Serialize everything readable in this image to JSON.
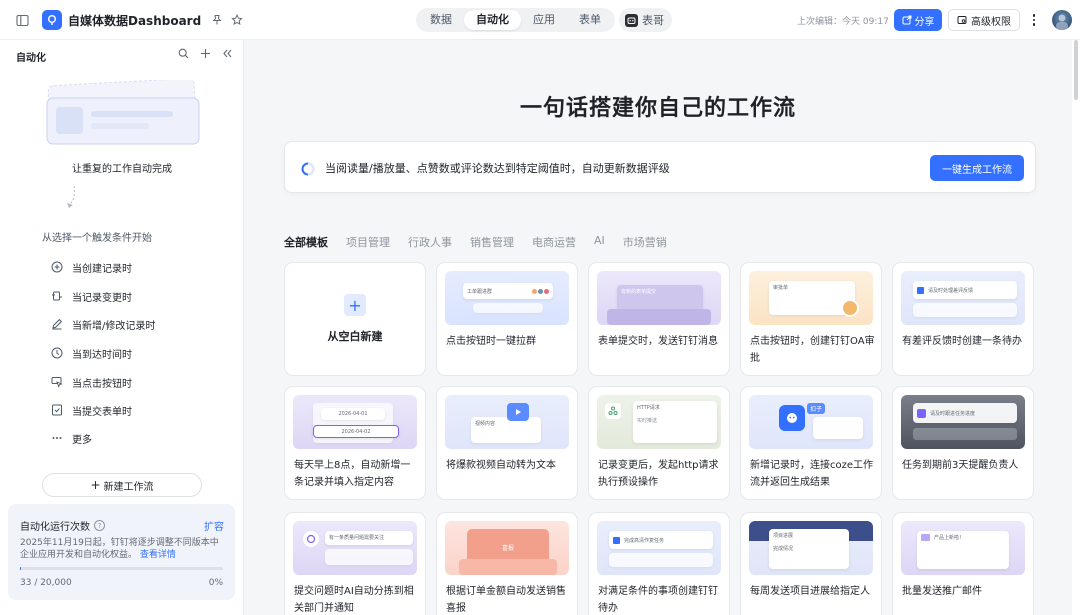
{
  "app": {
    "title": "自媒体数据Dashboard"
  },
  "nav": {
    "tabs": [
      {
        "label": "数据",
        "active": false
      },
      {
        "label": "自动化",
        "active": true
      },
      {
        "label": "应用",
        "active": false
      },
      {
        "label": "表单",
        "active": false
      }
    ],
    "biaoge_label": "表哥"
  },
  "header": {
    "last_edit": "上次编辑：今天 09:17",
    "share_label": "分享",
    "permission_label": "高级权限"
  },
  "sidebar": {
    "title": "自动化",
    "caption": "让重复的工作自动完成",
    "subtitle": "从选择一个触发条件开始",
    "triggers": [
      {
        "label": "当创建记录时",
        "icon": "plus-circle-icon"
      },
      {
        "label": "当记录变更时",
        "icon": "record-change-icon"
      },
      {
        "label": "当新增/修改记录时",
        "icon": "pencil-icon"
      },
      {
        "label": "当到达时间时",
        "icon": "clock-icon"
      },
      {
        "label": "当点击按钮时",
        "icon": "cursor-click-icon"
      },
      {
        "label": "当提交表单时",
        "icon": "form-submit-icon"
      },
      {
        "label": "更多",
        "icon": "ellipsis-icon"
      }
    ],
    "new_flow_label": "新建工作流",
    "quota": {
      "title": "自动化运行次数",
      "expand_label": "扩容",
      "description": "2025年11月19日起，钉钉将逐步调整不同版本中企业应用开发和自动化权益。",
      "details_link": "查看详情",
      "used_text": "33 / 20,000",
      "percent_text": "0%",
      "progress": 0.00165
    }
  },
  "main": {
    "hero_title": "一句话搭建你自己的工作流",
    "prompt_text": "当阅读量/播放量、点赞数或评论数达到特定阈值时，自动更新数据评级",
    "generate_label": "一键生成工作流",
    "categories": [
      {
        "label": "全部模板",
        "active": true
      },
      {
        "label": "项目管理",
        "active": false
      },
      {
        "label": "行政人事",
        "active": false
      },
      {
        "label": "销售管理",
        "active": false
      },
      {
        "label": "电商运营",
        "active": false
      },
      {
        "label": "AI",
        "active": false
      },
      {
        "label": "市场营销",
        "active": false
      }
    ],
    "blank_card_label": "从空白新建",
    "templates": [
      {
        "title": "点击按钮时一键拉群",
        "thumb_text": "工单跟进群"
      },
      {
        "title": "表单提交时，发送钉钉消息",
        "thumb_text": "有新的表单提交"
      },
      {
        "title": "点击按钮时，创建钉钉OA审批",
        "thumb_text": "审批单"
      },
      {
        "title": "有差评反馈时创建一条待办",
        "thumb_text": "请及时处理差评反馈"
      },
      {
        "title": "每天早上8点，自动新增一条记录并填入指定内容",
        "thumb_text": "2026-04-01",
        "thumb_text_2": "2026-04-02"
      },
      {
        "title": "将爆款视频自动转为文本",
        "thumb_text": "视频内容"
      },
      {
        "title": "记录变更后，发起http请求执行预设操作",
        "thumb_text": "HTTP请求",
        "thumb_text_2": "实时推送"
      },
      {
        "title": "新增记录时，连接coze工作流并返回生成结果",
        "thumb_text": "扣子"
      },
      {
        "title": "任务到期前3天提醒负责人",
        "thumb_text": "请及时跟进任务进度"
      },
      {
        "title": "提交问题时AI自动分拣到相关部门并通知",
        "thumb_text": "有一条质量问题需要关注"
      },
      {
        "title": "根据订单金额自动发送销售喜报",
        "thumb_text": "喜报"
      },
      {
        "title": "对满足条件的事项创建钉钉待办",
        "thumb_text": "完成高清作复任务"
      },
      {
        "title": "每周发送项目进展给指定人",
        "thumb_text": "项目进展",
        "thumb_text_2": "完成情况"
      },
      {
        "title": "批量发送推广邮件",
        "thumb_text": "产品上新啦！"
      }
    ]
  },
  "colors": {
    "accent": "#3370ff",
    "main_bg": "#f5f6f7",
    "quota_bg": "#f0f3fa"
  }
}
